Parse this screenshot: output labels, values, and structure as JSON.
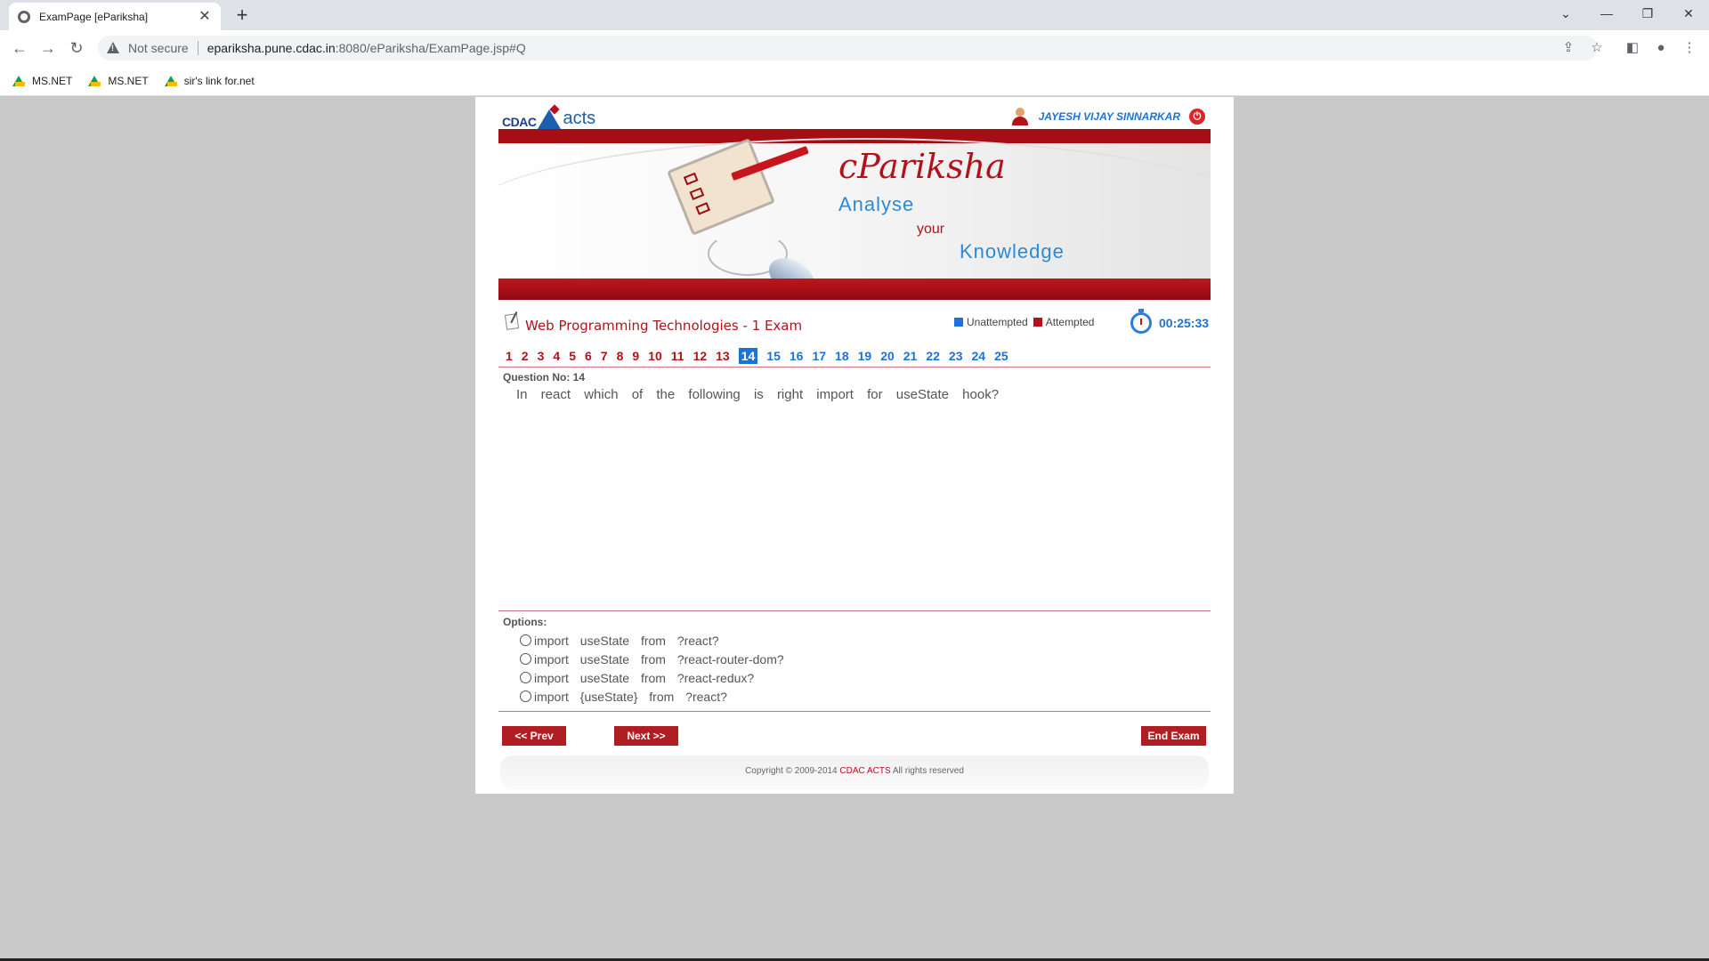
{
  "browser": {
    "tab_title": "ExamPage [ePariksha]",
    "tab_close": "✕",
    "new_tab": "+",
    "not_secure": "Not secure",
    "url_host": "epariksha.pune.cdac.in",
    "url_path": ":8080/ePariksha/ExamPage.jsp#Q",
    "bookmarks": [
      {
        "label": "MS.NET",
        "icon": "drive-icon"
      },
      {
        "label": "MS.NET",
        "icon": "drive-icon"
      },
      {
        "label": "sir's link for.net",
        "icon": "drive-icon"
      }
    ]
  },
  "header": {
    "logo_cdac": "CDAC",
    "logo_acts": "acts",
    "user_name": "JAYESH VIJAY SINNARKAR"
  },
  "banner": {
    "brand": "cPariksha",
    "tagline_1": "Analyse",
    "tagline_2": "your",
    "tagline_3": "Knowledge"
  },
  "exam": {
    "title": "Web Programming Technologies - 1 Exam",
    "legend_unattempted": "Unattempted",
    "legend_attempted": "Attempted",
    "timer": "00:25:33",
    "colors": {
      "attempted": "#b3121a",
      "unattempted": "#1b73d6",
      "current_bg": "#1b73d6"
    },
    "questions": [
      {
        "n": "1",
        "state": "attempted"
      },
      {
        "n": "2",
        "state": "attempted"
      },
      {
        "n": "3",
        "state": "attempted"
      },
      {
        "n": "4",
        "state": "attempted"
      },
      {
        "n": "5",
        "state": "attempted"
      },
      {
        "n": "6",
        "state": "attempted"
      },
      {
        "n": "7",
        "state": "attempted"
      },
      {
        "n": "8",
        "state": "attempted"
      },
      {
        "n": "9",
        "state": "attempted"
      },
      {
        "n": "10",
        "state": "attempted"
      },
      {
        "n": "11",
        "state": "attempted"
      },
      {
        "n": "12",
        "state": "attempted"
      },
      {
        "n": "13",
        "state": "attempted"
      },
      {
        "n": "14",
        "state": "current"
      },
      {
        "n": "15",
        "state": "unattempted"
      },
      {
        "n": "16",
        "state": "unattempted"
      },
      {
        "n": "17",
        "state": "unattempted"
      },
      {
        "n": "18",
        "state": "unattempted"
      },
      {
        "n": "19",
        "state": "unattempted"
      },
      {
        "n": "20",
        "state": "unattempted"
      },
      {
        "n": "21",
        "state": "unattempted"
      },
      {
        "n": "22",
        "state": "unattempted"
      },
      {
        "n": "23",
        "state": "unattempted"
      },
      {
        "n": "24",
        "state": "unattempted"
      },
      {
        "n": "25",
        "state": "unattempted"
      }
    ]
  },
  "question": {
    "label": "Question No: 14",
    "text": "In react which of the following is right import for useState hook?"
  },
  "options": {
    "label": "Options:",
    "items": [
      "import useState from ?react?",
      "import useState from ?react-router-dom?",
      "import useState from ?react-redux?",
      "import {useState} from ?react?"
    ]
  },
  "buttons": {
    "prev": "<< Prev",
    "next": "Next >>",
    "end": "End Exam"
  },
  "footer": {
    "prefix": "Copyright © 2009-2014 ",
    "org": "CDAC ACTS",
    "suffix": " All rights reserved"
  }
}
